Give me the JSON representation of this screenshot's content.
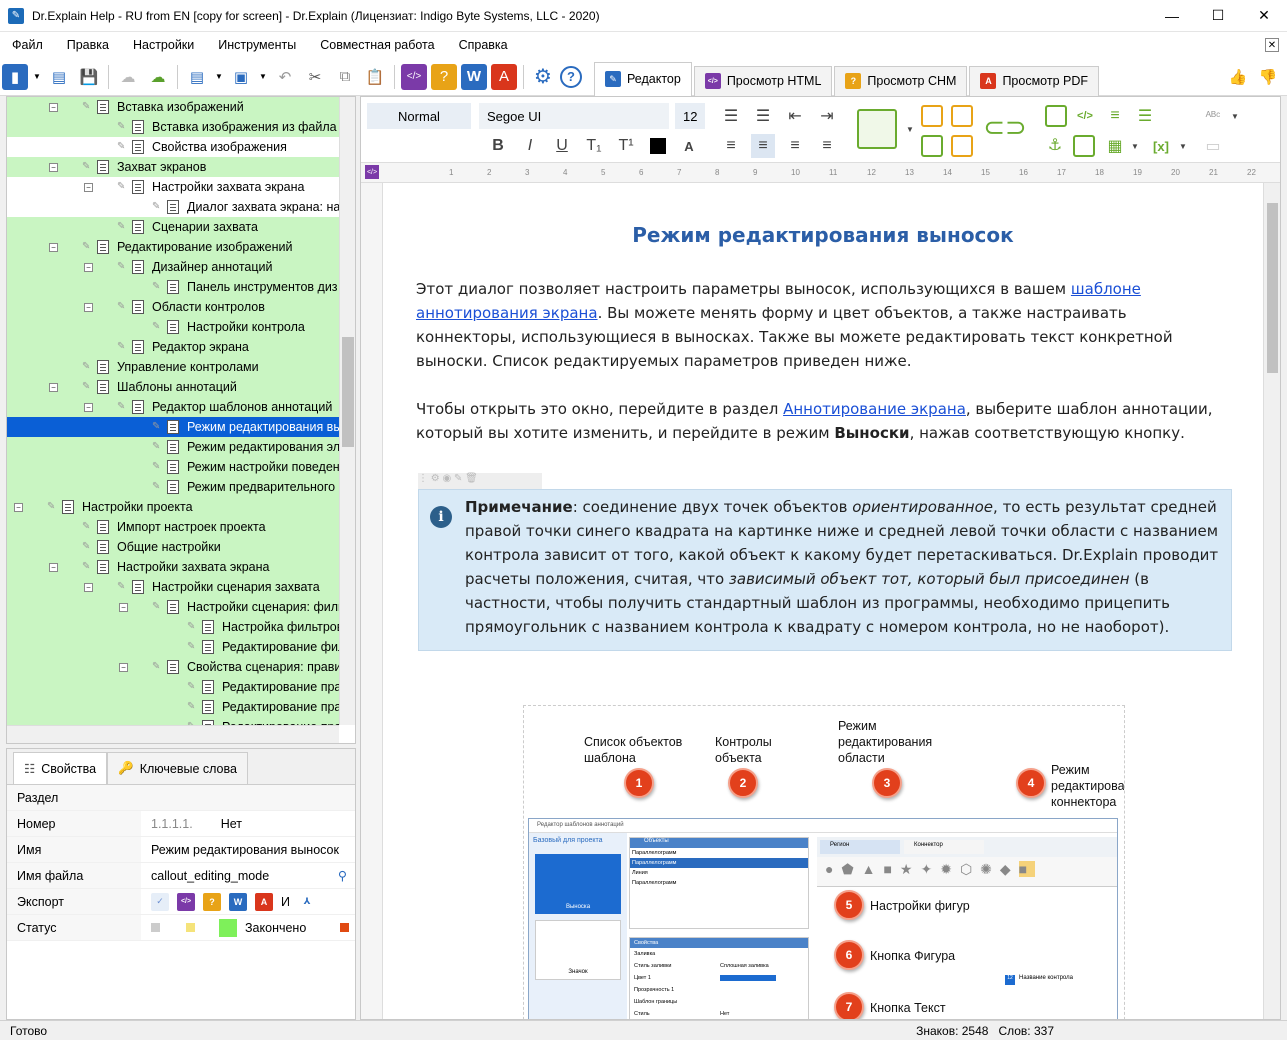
{
  "window": {
    "title": "Dr.Explain Help - RU from EN [copy for screen] - Dr.Explain (Лицензиат: Indigo Byte Systems, LLC - 2020)"
  },
  "menu": [
    "Файл",
    "Правка",
    "Настройки",
    "Инструменты",
    "Совместная работа",
    "Справка"
  ],
  "tabs": [
    {
      "label": "Редактор",
      "color": "#2a6bbf",
      "glyph": "✎"
    },
    {
      "label": "Просмотр HTML",
      "color": "#7b3aa8",
      "glyph": "</>"
    },
    {
      "label": "Просмотр CHM",
      "color": "#e8a317",
      "glyph": "?"
    },
    {
      "label": "Просмотр PDF",
      "color": "#d9361c",
      "glyph": "A"
    }
  ],
  "format": {
    "style": "Normal",
    "font": "Segoe UI",
    "size": "12"
  },
  "tree": [
    {
      "label": "Вставка изображений",
      "depth": 3,
      "toggle": "⊟",
      "bg": "green"
    },
    {
      "label": "Вставка изображения из файла",
      "depth": 4,
      "bg": "green"
    },
    {
      "label": "Свойства изображения",
      "depth": 4,
      "bg": "white"
    },
    {
      "label": "Захват экранов",
      "depth": 3,
      "toggle": "⊟",
      "bg": "green"
    },
    {
      "label": "Настройки захвата экрана",
      "depth": 4,
      "toggle": "⊟",
      "bg": "white"
    },
    {
      "label": "Диалог захвата экрана: на",
      "depth": 5,
      "bg": "white"
    },
    {
      "label": "Сценарии захвата",
      "depth": 4,
      "bg": "green"
    },
    {
      "label": "Редактирование изображений",
      "depth": 3,
      "toggle": "⊟",
      "bg": "green"
    },
    {
      "label": "Дизайнер аннотаций",
      "depth": 4,
      "toggle": "⊟",
      "bg": "green"
    },
    {
      "label": "Панель инструментов диз",
      "depth": 5,
      "bg": "green"
    },
    {
      "label": "Области контролов",
      "depth": 4,
      "toggle": "⊟",
      "bg": "green"
    },
    {
      "label": "Настройки контрола",
      "depth": 5,
      "bg": "green"
    },
    {
      "label": "Редактор экрана",
      "depth": 4,
      "bg": "green"
    },
    {
      "label": "Управление контролами",
      "depth": 3,
      "bg": "green"
    },
    {
      "label": "Шаблоны аннотаций",
      "depth": 3,
      "toggle": "⊟",
      "bg": "green"
    },
    {
      "label": "Редактор шаблонов аннотаций",
      "depth": 4,
      "toggle": "⊟",
      "bg": "green"
    },
    {
      "label": "Режим редактирования вы",
      "depth": 5,
      "bg": "sel"
    },
    {
      "label": "Режим редактирования эл",
      "depth": 5,
      "bg": "green"
    },
    {
      "label": "Режим настройки поведен",
      "depth": 5,
      "bg": "green"
    },
    {
      "label": "Режим предварительного",
      "depth": 5,
      "bg": "green"
    },
    {
      "label": "Настройки проекта",
      "depth": 2,
      "toggle": "⊟",
      "bg": "green"
    },
    {
      "label": "Импорт настроек проекта",
      "depth": 3,
      "bg": "green"
    },
    {
      "label": "Общие настройки",
      "depth": 3,
      "bg": "green"
    },
    {
      "label": "Настройки захвата экрана",
      "depth": 3,
      "toggle": "⊟",
      "bg": "green"
    },
    {
      "label": "Настройки сценария захвата",
      "depth": 4,
      "toggle": "⊟",
      "bg": "green"
    },
    {
      "label": "Настройки сценария: филь",
      "depth": 5,
      "toggle": "⊟",
      "bg": "green"
    },
    {
      "label": "Настройка фильтров",
      "depth": 6,
      "bg": "green"
    },
    {
      "label": "Редактирование фил",
      "depth": 6,
      "bg": "green"
    },
    {
      "label": "Свойства сценария: прави",
      "depth": 5,
      "toggle": "⊟",
      "bg": "green"
    },
    {
      "label": "Редактирование пра",
      "depth": 6,
      "bg": "green"
    },
    {
      "label": "Редактирование пра",
      "depth": 6,
      "bg": "green"
    },
    {
      "label": "Редактирование пра",
      "depth": 6,
      "bg": "green"
    }
  ],
  "props_tabs": [
    "Свойства",
    "Ключевые слова"
  ],
  "props": {
    "section": "Раздел",
    "number_k": "Номер",
    "number_v1": "1.1.1.1.",
    "number_v2": "Нет",
    "name_k": "Имя",
    "name_v": "Режим редактирования выносок",
    "file_k": "Имя файла",
    "file_v": "callout_editing_mode",
    "export_k": "Экспорт",
    "export_v": "И",
    "status_k": "Статус",
    "status_v": "Закончено"
  },
  "doc": {
    "title": "Режим редактирования выносок",
    "p1a": "Этот диалог позволяет настроить параметры выносок, использующихся в вашем ",
    "p1link": "шаблоне аннотирования экрана",
    "p1b": ". Вы можете менять форму и цвет объектов, а также настраивать коннекторы, использующиеся в выносках. Также вы можете редактировать текст конкретной выноски. Список редактируемых параметров приведен ниже.",
    "p2a": "Чтобы открыть это окно, перейдите в раздел ",
    "p2link": "Аннотирование экрана",
    "p2b": ", выберите шаблон аннотации, который вы хотите изменить, и перейдите в режим ",
    "p2bold": "Выноски",
    "p2c": ", нажав соответствующую кнопку.",
    "note_bold": "Примечание",
    "note_a": ": соединение двух точек объектов ",
    "note_i1": "ориентированное",
    "note_b": ", то есть результат средней правой точки синего квадрата на картинке ниже и средней левой точки области с названием контрола зависит от того, какой объект к какому будет перетаскиваться. Dr.Explain проводит расчеты положения, считая, что ",
    "note_i2": "зависимый объект тот, который был присоединен",
    "note_c": " (в частности, чтобы получить стандартный шаблон из программы, необходимо прицепить прямоугольник с названием контрола к квадрату с номером контрола, но не наоборот)."
  },
  "figure": {
    "c1": "Список объектов шаблона",
    "c2": "Контролы объекта",
    "c3": "Режим редактирования области",
    "c4": "Режим редактирования коннектора",
    "c5": "Настройки фигур",
    "c6": "Кнопка Фигура",
    "c7": "Кнопка Текст",
    "ss_title": "Редактор шаблонов аннотаций",
    "ss_left": "Базовый для проекта",
    "ss_objs": "Объекты",
    "ss_items": [
      "Параллелограмм",
      "Параллелограмм",
      "Линия",
      "Параллелограмм"
    ],
    "ss_tab1": "Регион",
    "ss_tab2": "Коннектор",
    "ss_thumb1": "Выноска",
    "ss_thumb2": "Значок",
    "ss_props": "Свойства",
    "ss_fill": "Заливка",
    "ss_fillstyle": "Стиль заливки",
    "ss_fillval": "Сплошная заливка",
    "ss_color": "Цвет 1",
    "ss_transp": "Прозрачность 1",
    "ss_border": "Шаблон границы",
    "ss_style": "Стиль",
    "ss_styleval": "Нет",
    "ss_ctrl": "Название контрола",
    "ss_num": "12"
  },
  "status": {
    "left": "Готово",
    "chars": "Знаков: 2548",
    "words": "Слов: 337"
  }
}
